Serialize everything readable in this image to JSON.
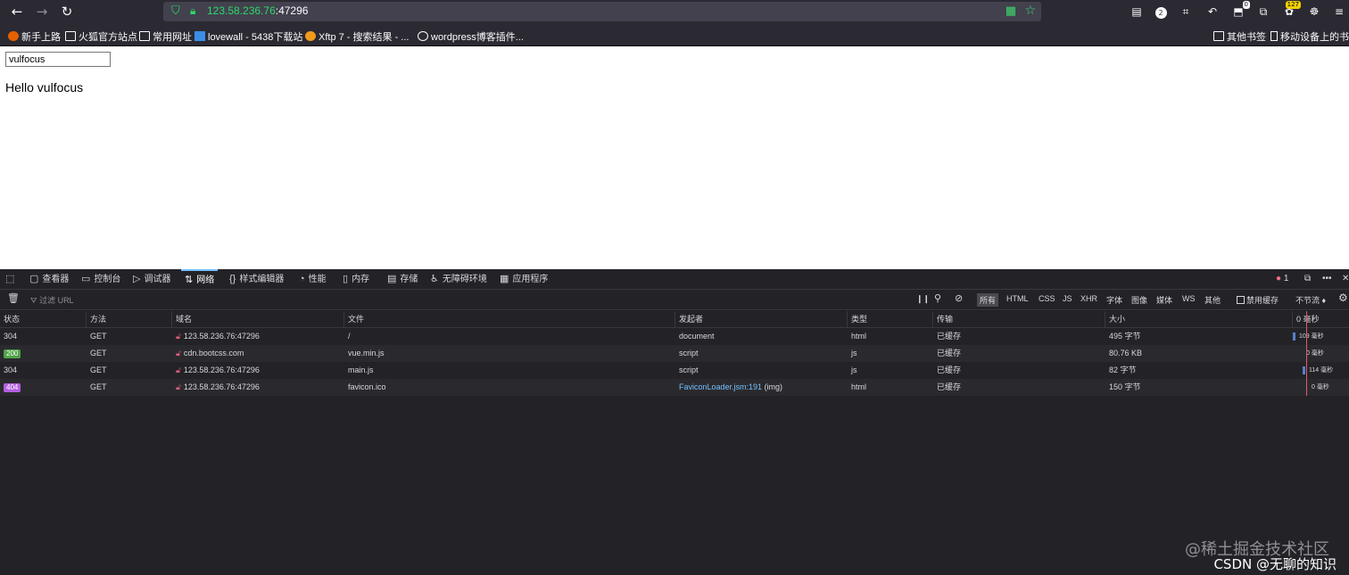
{
  "browser": {
    "url_host": "123.58.236.76",
    "url_port": ":47296",
    "badges": {
      "notif_count": "2",
      "ext_count": "0",
      "ext2_count": "127"
    }
  },
  "bookmarks": [
    {
      "label": "新手上路",
      "icon": "firefox-icon"
    },
    {
      "label": "火狐官方站点",
      "icon": "folder-icon"
    },
    {
      "label": "常用网址",
      "icon": "folder-icon"
    },
    {
      "label": "lovewall - 5438下载站",
      "icon": "site-icon"
    },
    {
      "label": "Xftp 7 - 搜索结果 - ...",
      "icon": "xftp-icon"
    },
    {
      "label": "wordpress博客插件...",
      "icon": "globe-icon"
    }
  ],
  "bookmarks_right": {
    "other": "其他书签",
    "mobile": "移动设备上的书签"
  },
  "page": {
    "input_value": "vulfocus",
    "hello": "Hello vulfocus"
  },
  "devtools": {
    "tabs": [
      "查看器",
      "控制台",
      "调试器",
      "网络",
      "样式编辑器",
      "性能",
      "内存",
      "存储",
      "无障碍环境",
      "应用程序"
    ],
    "active_tab": "网络",
    "error_count": "1",
    "filter_placeholder": "过滤 URL",
    "filters": [
      "所有",
      "HTML",
      "CSS",
      "JS",
      "XHR",
      "字体",
      "图像",
      "媒体",
      "WS",
      "其他"
    ],
    "disable_cache": "禁用缓存",
    "throttle": "不节流 ♦",
    "columns": [
      "状态",
      "方法",
      "域名",
      "文件",
      "发起者",
      "类型",
      "传输",
      "大小",
      "0 毫秒"
    ],
    "rows": [
      {
        "status": "304",
        "method": "GET",
        "domain": "123.58.236.76:47296",
        "file": "/",
        "initiator": "document",
        "initiator_suffix": "",
        "type": "html",
        "transfer": "已缓存",
        "size": "495 字节",
        "time": "109 毫秒"
      },
      {
        "status": "200",
        "method": "GET",
        "domain": "cdn.bootcss.com",
        "file": "vue.min.js",
        "initiator": "script",
        "initiator_suffix": "",
        "type": "js",
        "transfer": "已缓存",
        "size": "80.76 KB",
        "time": "0 毫秒"
      },
      {
        "status": "304",
        "method": "GET",
        "domain": "123.58.236.76:47296",
        "file": "main.js",
        "initiator": "script",
        "initiator_suffix": "",
        "type": "js",
        "transfer": "已缓存",
        "size": "82 字节",
        "time": "114 毫秒"
      },
      {
        "status": "404",
        "method": "GET",
        "domain": "123.58.236.76:47296",
        "file": "favicon.ico",
        "initiator": "FaviconLoader.jsm:191",
        "initiator_suffix": " (img)",
        "type": "html",
        "transfer": "已缓存",
        "size": "150 字节",
        "time": "0 毫秒"
      }
    ]
  },
  "watermark": {
    "line1": "@稀土掘金技术社区",
    "line2": "CSDN @无聊的知识"
  }
}
